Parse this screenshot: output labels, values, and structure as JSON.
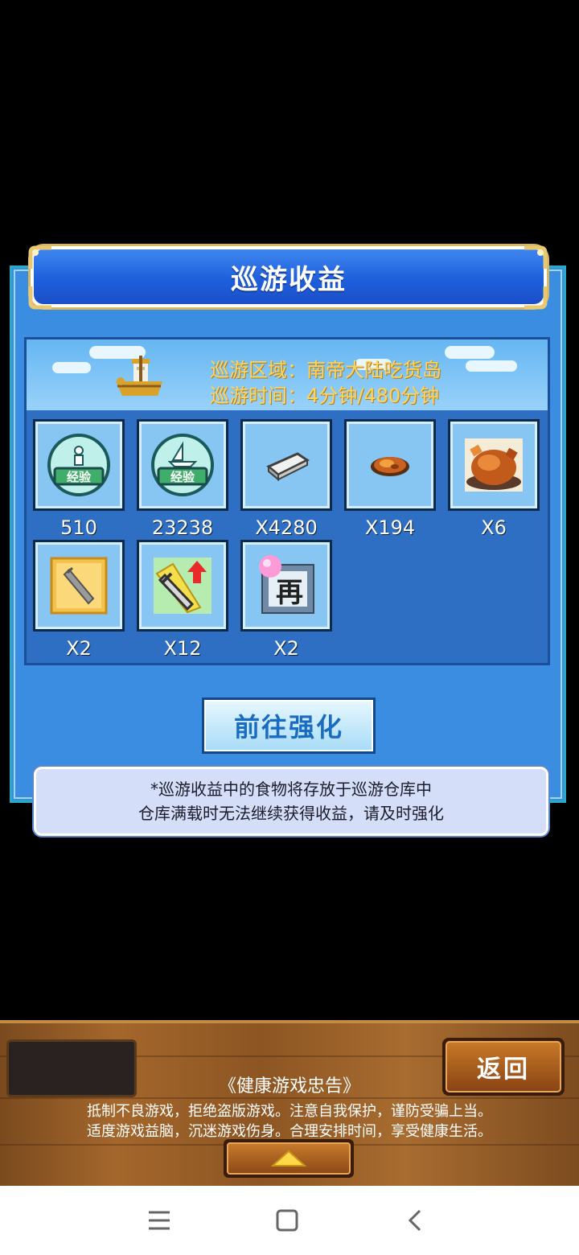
{
  "dialog": {
    "title": "巡游收益",
    "region_line": "巡游区域：南帝大陆吃货岛",
    "time_line": "巡游时间：4分钟/480分钟",
    "rewards": [
      {
        "icon": "staff-exp-icon",
        "count": "510"
      },
      {
        "icon": "ship-exp-icon",
        "count": "23238"
      },
      {
        "icon": "silver-ingot-icon",
        "count": "X4280"
      },
      {
        "icon": "roast-meat-icon",
        "count": "X194"
      },
      {
        "icon": "roast-chicken-icon",
        "count": "X6"
      },
      {
        "icon": "sword-card-icon",
        "count": "X2"
      },
      {
        "icon": "sword-upgrade-icon",
        "count": "X12"
      },
      {
        "icon": "recruit-ticket-icon",
        "count": "X2"
      }
    ],
    "exp_badge_text": "经验",
    "recruit_char": "再",
    "goto_button": "前往强化",
    "note_line1": "*巡游收益中的食物将存放于巡游仓库中",
    "note_line2": "仓库满载时无法继续获得收益，请及时强化"
  },
  "footer": {
    "back_button": "返回",
    "health_title": "《健康游戏忠告》",
    "health_line1": "抵制不良游戏，拒绝盗版游戏。注意自我保护，谨防受骗上当。",
    "health_line2": "适度游戏益脑，沉迷游戏伤身。合理安排时间，享受健康生活。"
  },
  "navbar": {
    "icons": [
      "menu-icon",
      "home-square-icon",
      "back-chevron-icon"
    ]
  },
  "colors": {
    "panel_blue": "#3a8de0",
    "title_blue": "#1e5fdc",
    "banner_text": "#ffd45a",
    "wood": "#a4672c"
  }
}
